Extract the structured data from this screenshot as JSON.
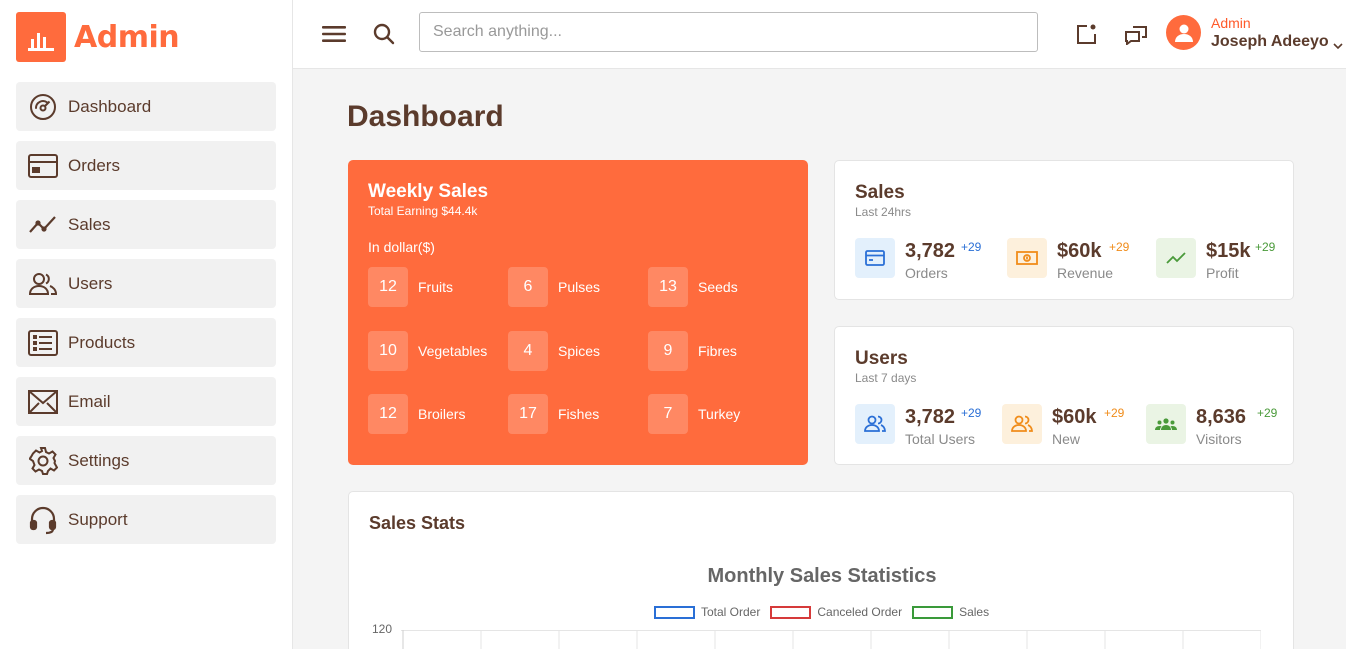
{
  "brand": {
    "name": "Admin"
  },
  "sidebar": {
    "items": [
      {
        "label": "Dashboard",
        "icon": "dashboard-gauge-icon"
      },
      {
        "label": "Orders",
        "icon": "credit-card-icon"
      },
      {
        "label": "Sales",
        "icon": "trend-line-icon"
      },
      {
        "label": "Users",
        "icon": "users-icon"
      },
      {
        "label": "Products",
        "icon": "list-icon"
      },
      {
        "label": "Email",
        "icon": "envelope-icon"
      },
      {
        "label": "Settings",
        "icon": "gear-icon"
      },
      {
        "label": "Support",
        "icon": "headset-icon"
      }
    ]
  },
  "header": {
    "search_placeholder": "Search anything...",
    "user_role": "Admin",
    "user_name": "Joseph Adeeyo"
  },
  "page": {
    "title": "Dashboard"
  },
  "weekly_sales": {
    "title": "Weekly Sales",
    "subtitle": "Total Earning $44.4k",
    "currency_note": "In dollar($)",
    "categories": [
      {
        "count": "12",
        "name": "Fruits"
      },
      {
        "count": "6",
        "name": "Pulses"
      },
      {
        "count": "13",
        "name": "Seeds"
      },
      {
        "count": "10",
        "name": "Vegetables"
      },
      {
        "count": "4",
        "name": "Spices"
      },
      {
        "count": "9",
        "name": "Fibres"
      },
      {
        "count": "12",
        "name": "Broilers"
      },
      {
        "count": "17",
        "name": "Fishes"
      },
      {
        "count": "7",
        "name": "Turkey"
      }
    ]
  },
  "sales_card": {
    "title": "Sales",
    "subtitle": "Last 24hrs",
    "stats": [
      {
        "value": "3,782",
        "delta": "+29",
        "label": "Orders",
        "icon": "card-icon",
        "color": "#2a6fd6",
        "bg": "#e3f0fc"
      },
      {
        "value": "$60k",
        "delta": "+29",
        "label": "Revenue",
        "icon": "cash-icon",
        "color": "#f08c1a",
        "bg": "#fdf0dc"
      },
      {
        "value": "$15k",
        "delta": "+29",
        "label": "Profit",
        "icon": "trend-icon",
        "color": "#4a9a3a",
        "bg": "#eaf4e4"
      }
    ]
  },
  "users_card": {
    "title": "Users",
    "subtitle": "Last 7 days",
    "stats": [
      {
        "value": "3,782",
        "delta": "+29",
        "label": "Total Users",
        "icon": "users-icon",
        "color": "#2a6fd6",
        "bg": "#e3f0fc"
      },
      {
        "value": "$60k",
        "delta": "+29",
        "label": "New",
        "icon": "users-icon",
        "color": "#f08c1a",
        "bg": "#fdf0dc"
      },
      {
        "value": "8,636",
        "delta": "+29",
        "label": "Visitors",
        "icon": "group-icon",
        "color": "#4a9a3a",
        "bg": "#eaf4e4"
      }
    ]
  },
  "sales_stats": {
    "title": "Sales Stats"
  },
  "chart_data": {
    "type": "line",
    "title": "Monthly Sales Statistics",
    "series": [
      {
        "name": "Total Order",
        "color": "#2a6fd6"
      },
      {
        "name": "Canceled Order",
        "color": "#d63a3a"
      },
      {
        "name": "Sales",
        "color": "#3a9a3a"
      }
    ],
    "y_tick_visible": "120",
    "grid": true,
    "legend_placement": "top-center"
  }
}
